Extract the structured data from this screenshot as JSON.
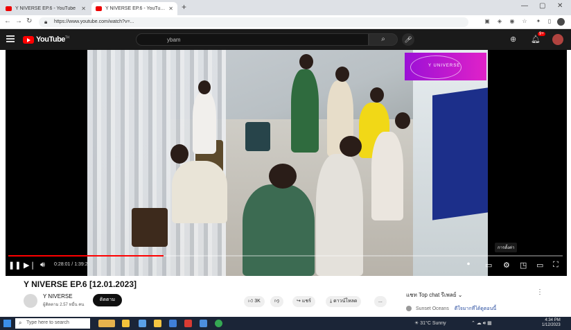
{
  "browser": {
    "tabs": [
      {
        "title": "Y NIVERSE EP.6 - YouTube",
        "active": false
      },
      {
        "title": "Y NIVERSE EP.6 - YouTube",
        "active": true
      }
    ],
    "url": "https://www.youtube.com/watch?v=..."
  },
  "masthead": {
    "logo_text": "YouTube",
    "logo_region": "TH",
    "search_value": "ybam",
    "notification_count": "9+"
  },
  "player": {
    "promo_text": "Y UNIVERSE",
    "time_display": "0:28:01 / 1:39:24",
    "progress_fraction": 0.28,
    "settings_tooltip": "การตั้งค่า"
  },
  "video": {
    "title": "Y NIVERSE EP.6 [12.01.2023]",
    "channel_name": "Y NIVERSE",
    "channel_subs": "ผู้ติดตาม 2.57 หมื่น คน",
    "subscribe_label": "ติดตาม",
    "like_count": "3K",
    "share_label": "แชร์",
    "download_label": "ดาวน์โหลด",
    "more_label": "..."
  },
  "chat": {
    "header": "แชท Top chat รีเพลย์",
    "line_user": "Sunset Oceans",
    "line_text": "ดีใจมากที่ได้ดูตอนนี้"
  },
  "taskbar": {
    "search_placeholder": "Type here to search",
    "weather": "31°C Sunny",
    "clock_time": "4:34 PM",
    "clock_date": "1/12/2023"
  },
  "colors": {
    "youtube_red": "#ff0000",
    "promo_gradient_start": "#9b10d6",
    "promo_gradient_end": "#e022c8",
    "taskbar_bg": "#1b2537"
  },
  "icons": {
    "browser": [
      "back-icon",
      "forward-icon",
      "reload-icon",
      "lock-icon",
      "star-icon",
      "extensions-icon",
      "profile-icon"
    ],
    "player": [
      "pause-icon",
      "next-icon",
      "volume-icon",
      "subtitles-icon",
      "settings-icon",
      "miniplayer-icon",
      "theater-icon",
      "fullscreen-icon"
    ],
    "actions": [
      "like-icon",
      "dislike-icon",
      "share-icon",
      "download-icon",
      "more-icon"
    ]
  }
}
